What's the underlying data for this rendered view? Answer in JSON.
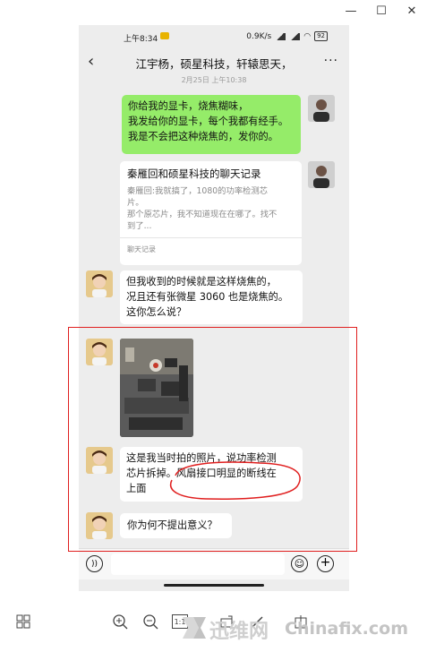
{
  "window_controls": {
    "minimize": "—",
    "maximize": "☐",
    "close": "✕"
  },
  "status_bar": {
    "time": "上午8:34",
    "speed": "0.9K/s",
    "battery": "92"
  },
  "chat": {
    "title": "江宇杨，硕星科技，轩辕思天，",
    "back_icon": "‹",
    "more_icon": "···",
    "timestamp": "2月25日 上午10:38"
  },
  "messages": {
    "m1": {
      "lines": [
        "你给我的显卡，烧焦糊味，",
        "我发给你的显卡，每个我都有经手。",
        "我是不会把这种烧焦的，发你的。"
      ]
    },
    "record": {
      "title": "秦雁回和硕星科技的聊天记录",
      "lines": [
        "秦雁回:我就搞了，1080的功率检测芯",
        "片。",
        "那个原芯片，我不知道现在在哪了。找不",
        "到了..."
      ],
      "footer": "聊天记录"
    },
    "m3": {
      "lines": [
        "但我收到的时候就是这样烧焦的，",
        "况且还有张微星 3060 也是烧焦的。",
        "这你怎么说？"
      ]
    },
    "m5": {
      "lines": [
        "这是我当时拍的照片，说功率检测",
        "芯片拆掉。风扇接口明显的断线在",
        "上面"
      ]
    },
    "m6": {
      "text": "你为何不提出意义？"
    }
  },
  "watermark": {
    "brand_cn": "迅维网",
    "brand_en": "Chinafix.com"
  },
  "toolbar": {
    "grid_icon": "grid-icon",
    "actual_size": "1:1"
  },
  "colors": {
    "green_bubble": "#95ec69",
    "chat_bg": "#ededed",
    "annotation_red": "#e01f1f"
  }
}
